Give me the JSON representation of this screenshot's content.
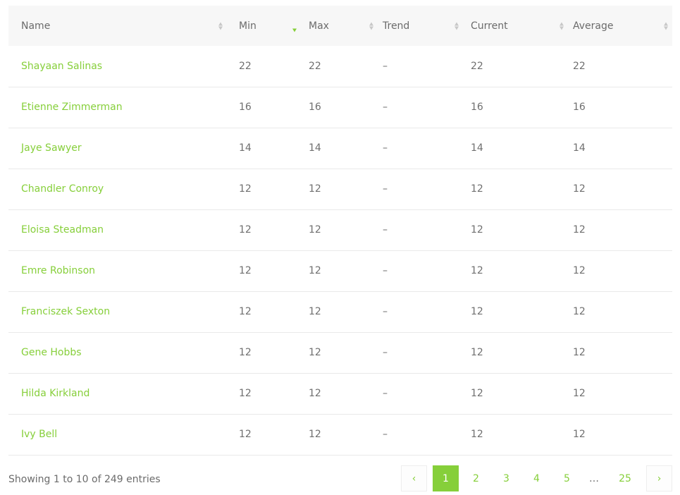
{
  "table": {
    "columns": [
      {
        "label": "Name",
        "sort": "none"
      },
      {
        "label": "Min",
        "sort": "desc"
      },
      {
        "label": "Max",
        "sort": "none"
      },
      {
        "label": "Trend",
        "sort": "none"
      },
      {
        "label": "Current",
        "sort": "none"
      },
      {
        "label": "Average",
        "sort": "none"
      }
    ],
    "rows": [
      {
        "name": "Shayaan Salinas",
        "min": "22",
        "max": "22",
        "trend": "–",
        "current": "22",
        "average": "22"
      },
      {
        "name": "Etienne Zimmerman",
        "min": "16",
        "max": "16",
        "trend": "–",
        "current": "16",
        "average": "16"
      },
      {
        "name": "Jaye Sawyer",
        "min": "14",
        "max": "14",
        "trend": "–",
        "current": "14",
        "average": "14"
      },
      {
        "name": "Chandler Conroy",
        "min": "12",
        "max": "12",
        "trend": "–",
        "current": "12",
        "average": "12"
      },
      {
        "name": "Eloisa Steadman",
        "min": "12",
        "max": "12",
        "trend": "–",
        "current": "12",
        "average": "12"
      },
      {
        "name": "Emre Robinson",
        "min": "12",
        "max": "12",
        "trend": "–",
        "current": "12",
        "average": "12"
      },
      {
        "name": "Franciszek Sexton",
        "min": "12",
        "max": "12",
        "trend": "–",
        "current": "12",
        "average": "12"
      },
      {
        "name": "Gene Hobbs",
        "min": "12",
        "max": "12",
        "trend": "–",
        "current": "12",
        "average": "12"
      },
      {
        "name": "Hilda Kirkland",
        "min": "12",
        "max": "12",
        "trend": "–",
        "current": "12",
        "average": "12"
      },
      {
        "name": "Ivy Bell",
        "min": "12",
        "max": "12",
        "trend": "–",
        "current": "12",
        "average": "12"
      }
    ]
  },
  "footer": {
    "info": "Showing 1 to 10 of 249 entries",
    "pagination": {
      "prev_icon": "chevron-left-icon",
      "prev_glyph": "‹",
      "next_icon": "chevron-right-icon",
      "next_glyph": "›",
      "pages": [
        "1",
        "2",
        "3",
        "4",
        "5"
      ],
      "ellipsis": "…",
      "last_page": "25",
      "current": "1"
    }
  },
  "colors": {
    "accent": "#86cf3a",
    "text": "#6f6f6f",
    "header_bg": "#f7f7f7",
    "row_border": "#e9e9e9"
  }
}
